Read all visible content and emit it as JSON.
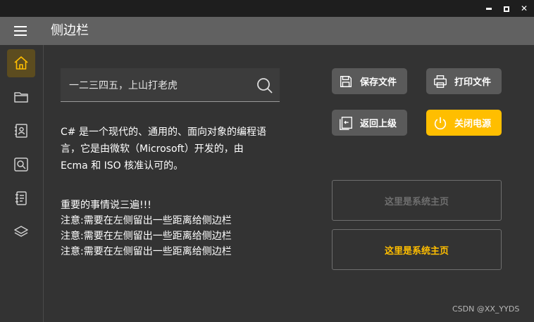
{
  "window": {
    "controls": {
      "minimize": "",
      "maximize": "",
      "close": "✕"
    }
  },
  "header": {
    "title": "侧边栏"
  },
  "sidebar": {
    "items": [
      {
        "icon": "home-icon",
        "active": true
      },
      {
        "icon": "folder-icon",
        "active": false
      },
      {
        "icon": "contact-card-icon",
        "active": false
      },
      {
        "icon": "search-screen-icon",
        "active": false
      },
      {
        "icon": "notebook-icon",
        "active": false
      },
      {
        "icon": "layers-icon",
        "active": false
      }
    ]
  },
  "search": {
    "value": "一二三四五，上山打老虎",
    "placeholder": ""
  },
  "description": {
    "lines": [
      "C# 是一个现代的、通用的、面向对象的编程语",
      "言，它是由微软（Microsoft）开发的，由",
      "Ecma 和 ISO 核准认可的。"
    ]
  },
  "notes": {
    "lines": [
      "重要的事情说三遍!!!",
      "注意:需要在左侧留出一些距离给侧边栏",
      "注意:需要在左侧留出一些距离给侧边栏",
      "注意:需要在左侧留出一些距离给侧边栏"
    ]
  },
  "buttons": {
    "save": "保存文件",
    "print": "打印文件",
    "back": "返回上级",
    "power": "关闭电源"
  },
  "panels": {
    "first": "这里是系统主页",
    "second": "这里是系统主页"
  },
  "watermark": "CSDN @XX_YYDS",
  "colors": {
    "accent": "#ffbe00",
    "header_bg": "#616161",
    "body_bg": "#333333",
    "button_bg": "#5a5a5a"
  }
}
